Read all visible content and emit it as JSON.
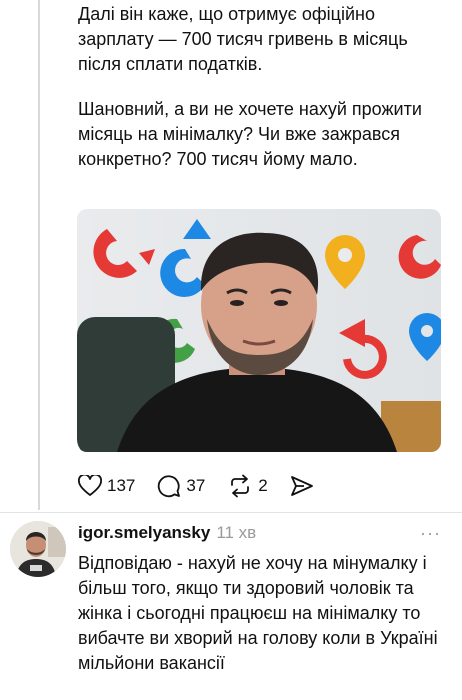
{
  "post": {
    "paragraph1": "Далі він каже, що отримує офіційно зарплату — 700 тисяч гривень в місяць після сплати податків.",
    "paragraph2": "Шановний, а ви не хочете нахуй прожити місяць на мінімалку? Чи вже зажрався конкретно? 700 тисяч йому мало.",
    "actions": {
      "likes": "137",
      "comments": "37",
      "reposts": "2"
    },
    "icons": [
      "heart-icon",
      "comment-icon",
      "repost-icon",
      "send-icon"
    ]
  },
  "reply": {
    "username": "igor.smelyansky",
    "time": "11 хв",
    "more": "···",
    "text": "Відповідаю - нахуй не хочу на мінумалку і більш того, якщо ти здоровий чоловік та жінка і сьогодні працюєш на мінімалку то вибачте ви хворий на голову коли в Україні мільйони вакансії"
  }
}
